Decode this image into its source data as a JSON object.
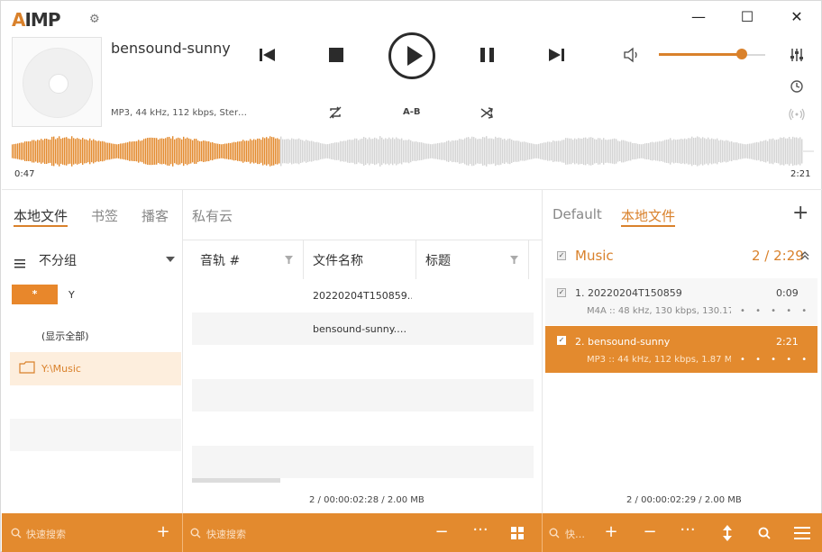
{
  "app": {
    "logo_a": "A",
    "logo_rest": "IMP"
  },
  "window": {
    "minimize": "—",
    "maximize": "☐",
    "close": "✕"
  },
  "player": {
    "title": "bensound-sunny",
    "info": "MP3, 44 kHz, 112 kbps, Ster…",
    "ab_label": "A-B",
    "time_elapsed": "0:47",
    "time_total": "2:21",
    "progress": 0.333,
    "volume": 0.78
  },
  "left_tabs": [
    "本地文件",
    "书签",
    "播客",
    "私有云"
  ],
  "groups": {
    "label": "不分组",
    "filter_all": "*",
    "filter_y": "Y",
    "show_all": "(显示全部)",
    "folder": "Y:\\Music"
  },
  "table": {
    "columns": [
      "音轨 #",
      "文件名称",
      "标题"
    ],
    "rows": [
      {
        "file": "20220204T150859.…"
      },
      {
        "file": "bensound-sunny.…"
      }
    ],
    "status": "2 / 00:00:02:28 / 2.00 MB"
  },
  "right_tabs": [
    "Default",
    "本地文件"
  ],
  "playlist": {
    "name": "Music",
    "count": "2 / 2:29",
    "items": [
      {
        "name": "1. 20220204T150859",
        "duration": "0:09",
        "meta": "M4A :: 48 kHz, 130 kbps, 130.17 …",
        "dots": "• • • • •"
      },
      {
        "name": "2. bensound-sunny",
        "duration": "2:21",
        "meta": "MP3 :: 44 kHz, 112 kbps, 1.87 MB",
        "dots": "• • • • •"
      }
    ],
    "status": "2 / 00:00:02:29 / 2.00 MB"
  },
  "bottom": {
    "search1": "快速搜索",
    "search2": "快速搜索",
    "search3": "快…"
  },
  "colors": {
    "accent": "#e38a2e"
  }
}
